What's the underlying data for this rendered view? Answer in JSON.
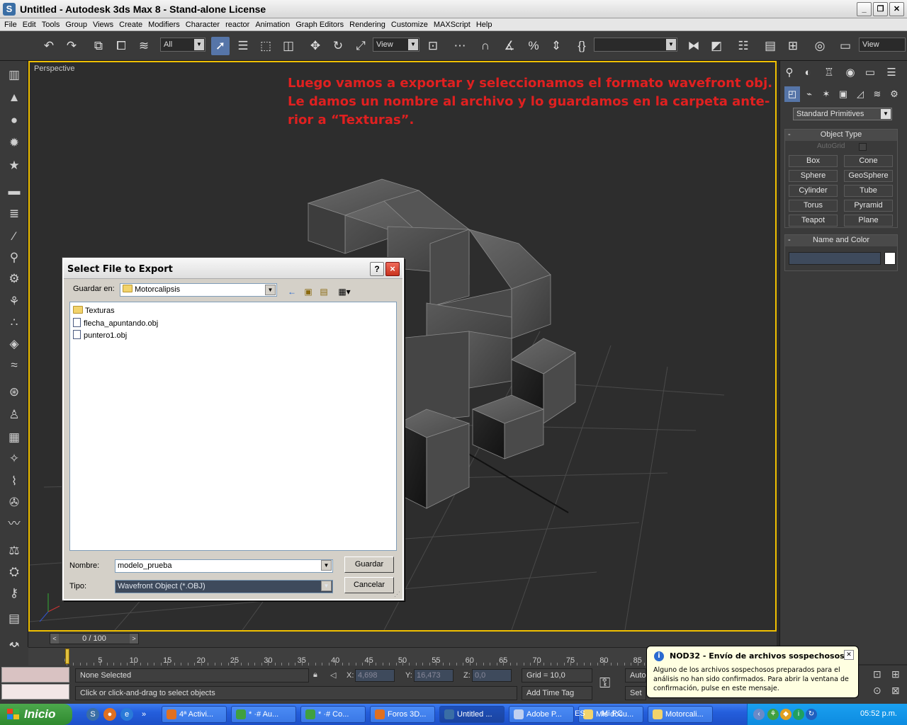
{
  "window": {
    "title": "Untitled - Autodesk 3ds Max 8  - Stand-alone License"
  },
  "menu": [
    "File",
    "Edit",
    "Tools",
    "Group",
    "Views",
    "Create",
    "Modifiers",
    "Character",
    "reactor",
    "Animation",
    "Graph Editors",
    "Rendering",
    "Customize",
    "MAXScript",
    "Help"
  ],
  "toolbar": {
    "selection_filter": "All",
    "ref_coord": "View",
    "named_sel": "",
    "view_right": "View"
  },
  "viewport": {
    "label": "Perspective",
    "annotation": [
      "Luego vamos a exportar y seleccionamos el formato wavefront obj.",
      "Le damos un nombre al archivo y lo guardamos en la carpeta ante-",
      "rior a “Texturas”."
    ]
  },
  "command_panel": {
    "category": "Standard Primitives",
    "object_type_title": "Object Type",
    "autogrid": "AutoGrid",
    "primitives": [
      "Box",
      "Cone",
      "Sphere",
      "GeoSphere",
      "Cylinder",
      "Tube",
      "Torus",
      "Pyramid",
      "Teapot",
      "Plane"
    ],
    "name_color_title": "Name and Color"
  },
  "dialog": {
    "title": "Select File to Export",
    "help": "?",
    "close": "×",
    "save_in_label": "Guardar en:",
    "save_in_value": "Motorcalipsis",
    "files": [
      {
        "name": "Texturas",
        "type": "folder"
      },
      {
        "name": "flecha_apuntando.obj",
        "type": "file"
      },
      {
        "name": "puntero1.obj",
        "type": "file"
      }
    ],
    "name_label": "Nombre:",
    "name_value": "modelo_prueba",
    "type_label": "Tipo:",
    "type_value": "Wavefront Object (*.OBJ)",
    "save_button": "Guardar",
    "cancel_button": "Cancelar"
  },
  "timeline": {
    "slider": "0 / 100",
    "ticks": [
      "0",
      "5",
      "10",
      "15",
      "20",
      "25",
      "30",
      "35",
      "40",
      "45",
      "50",
      "55",
      "60",
      "65",
      "70",
      "75",
      "80",
      "85"
    ]
  },
  "status": {
    "selection": "None Selected",
    "prompt": "Click or click-and-drag to select objects",
    "x_label": "X:",
    "x_value": "4,698",
    "y_label": "Y:",
    "y_value": "16,473",
    "z_label": "Z:",
    "z_value": "0,0",
    "grid": "Grid = 10,0",
    "add_time_tag": "Add Time Tag",
    "auto_key": "Auto",
    "set_key": "Set"
  },
  "balloon": {
    "title": "NOD32 - Envío de archivos sospechosos",
    "text": "Alguno de los archivos sospechosos preparados para el análisis no han sido confirmados. Para abrir la ventana de confirmación, pulse en este mensaje."
  },
  "taskbar": {
    "start": "Inicio",
    "tasks": [
      "4ª Activi...",
      "* ·# Au...",
      "* ·# Co...",
      "Foros 3D...",
      "Untitled ...",
      "Adobe P...",
      "Mis docu...",
      "Motorcali..."
    ],
    "lang": "ES",
    "mypc": "Mi PC",
    "clock": "05:52 p.m."
  },
  "colors": {
    "annotation": "#e02020",
    "viewport_border": "#f0c000",
    "taskbar": "#245edc",
    "start": "#2f8a2f"
  }
}
